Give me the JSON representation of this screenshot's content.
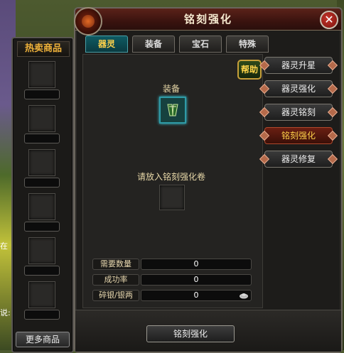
{
  "window": {
    "title": "铭刻强化",
    "close_label": "✕"
  },
  "shop": {
    "title": "热卖商品",
    "more_label": "更多商品"
  },
  "tabs": [
    {
      "label": "器灵",
      "active": true
    },
    {
      "label": "装备",
      "active": false
    },
    {
      "label": "宝石",
      "active": false
    },
    {
      "label": "特殊",
      "active": false
    }
  ],
  "help_label": "帮助",
  "equip_label": "装备",
  "scroll_label": "请放入铭刻强化卷",
  "stats": [
    {
      "label": "需要数量",
      "value": "0"
    },
    {
      "label": "成功率",
      "value": "0"
    },
    {
      "label": "碎银/银两",
      "value": "0"
    }
  ],
  "side_buttons": [
    {
      "label": "器灵升星",
      "active": false
    },
    {
      "label": "器灵强化",
      "active": false
    },
    {
      "label": "器灵铭刻",
      "active": false
    },
    {
      "label": "铭刻强化",
      "active": true
    },
    {
      "label": "器灵修复",
      "active": false
    }
  ],
  "action_label": "铭刻强化",
  "colors": {
    "accent_gold": "#ffd14a",
    "tab_active": "#0f5b63",
    "button_active": "#6a1f12",
    "title_bar": "#5b2219"
  },
  "icons": [
    "item-orb-icon",
    "close-icon",
    "equipment-icon",
    "silver-coin-icon"
  ],
  "bg_text": {
    "left_1": "在",
    "left_2": "说:"
  }
}
